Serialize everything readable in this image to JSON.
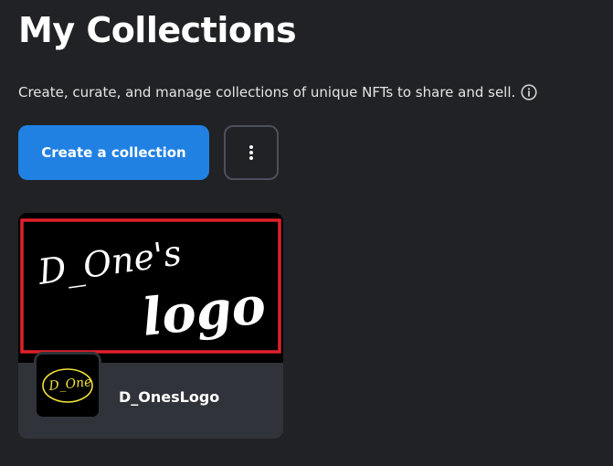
{
  "header": {
    "title": "My Collections",
    "subtitle": "Create, curate, and manage collections of unique NFTs to share and sell."
  },
  "actions": {
    "create_label": "Create a collection",
    "more_icon": "more-vertical-icon"
  },
  "icons": {
    "info": "info-icon"
  },
  "collections": [
    {
      "name": "D_OnesLogo",
      "banner_text_1": "D_One's",
      "banner_text_2": "logo",
      "avatar_text": "D_One"
    }
  ],
  "colors": {
    "background": "#202225",
    "accent": "#2081e2",
    "card": "#303339",
    "banner_border": "#e0202a",
    "avatar_text": "#f2e13a"
  }
}
